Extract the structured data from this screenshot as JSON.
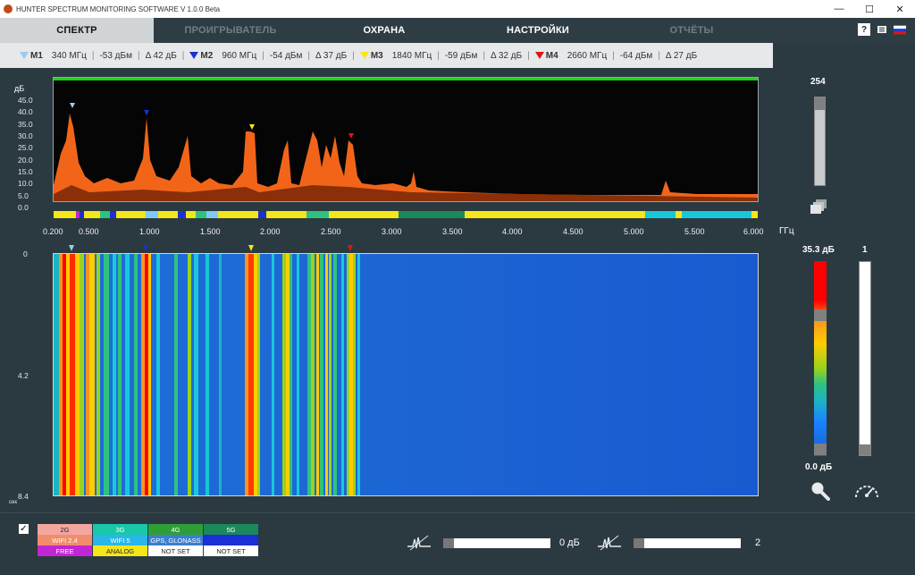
{
  "window": {
    "title": "HUNTER SPECTRUM MONITORING SOFTWARE V 1.0.0 Beta",
    "minimize": "—",
    "maximize": "☐",
    "close": "✕"
  },
  "tabs": [
    {
      "label": "СПЕКТР",
      "state": "active"
    },
    {
      "label": "ПРОИГРЫВАТЕЛЬ",
      "state": "dim"
    },
    {
      "label": "ОХРАНА",
      "state": "normal"
    },
    {
      "label": "НАСТРОЙКИ",
      "state": "normal"
    },
    {
      "label": "ОТЧЁТЫ",
      "state": "dim"
    }
  ],
  "toolbar_icons": [
    "help-icon",
    "document-icon",
    "russian-flag-icon"
  ],
  "help_label": "?",
  "markers": [
    {
      "name": "M1",
      "freq": "340 МГц",
      "level": "-53 дБм",
      "delta": "Δ 42 дБ",
      "color": "#9fc9ea"
    },
    {
      "name": "M2",
      "freq": "960 МГц",
      "level": "-54 дБм",
      "delta": "Δ 37 дБ",
      "color": "#1b2fd6"
    },
    {
      "name": "M3",
      "freq": "1840 МГц",
      "level": "-59 дБм",
      "delta": "Δ 32 дБ",
      "color": "#f5e61a"
    },
    {
      "name": "M4",
      "freq": "2660 МГц",
      "level": "-64 дБм",
      "delta": "Δ 27 дБ",
      "color": "#e01515"
    }
  ],
  "spectrum": {
    "y_unit": "дБ",
    "y_ticks": [
      "45.0",
      "40.0",
      "35.0",
      "30.0",
      "25.0",
      "20.0",
      "15.0",
      "10.0",
      "5.0",
      "0.0"
    ],
    "x_unit": "ГГц",
    "x_ticks": [
      "0.200",
      "0.500",
      "1.000",
      "1.500",
      "2.000",
      "2.500",
      "3.000",
      "3.500",
      "4.000",
      "4.500",
      "5.000",
      "5.500",
      "6.000"
    ],
    "band_colors": [
      "#f5e61a",
      "#c026d3",
      "#1b2fd6",
      "#f5e61a",
      "#2ec27e",
      "#1b2fd6",
      "#f5e61a",
      "#7fc8f8",
      "#f5e61a",
      "#1b2fd6",
      "#f5e61a",
      "#2ec27e",
      "#7fc8f8",
      "#f5e61a",
      "#1b2fd6",
      "#f5e61a",
      "#2ec27e",
      "#f5e61a",
      "#1a8a5a",
      "#f5e61a",
      "#18c8d8",
      "#f5e61a",
      "#18c8d8",
      "#f5e61a"
    ]
  },
  "waterfall": {
    "y_ticks": [
      "0",
      "4.2",
      "8.4"
    ],
    "y_unit": "сек"
  },
  "right_panel": {
    "gain_value": "254",
    "max_level": "35.3 дБ",
    "min_level": "0.0 дБ",
    "speed_value": "1",
    "icons": [
      "layers-icon",
      "zoom-icon",
      "speedometer-icon"
    ]
  },
  "legend": {
    "checked": "✓",
    "rows": [
      [
        {
          "label": "2G",
          "color": "#f3a6a0"
        },
        {
          "label": "3G",
          "color": "#18c8a8"
        },
        {
          "label": "4G",
          "color": "#2e9e38"
        },
        {
          "label": "5G",
          "color": "#1a8a5a"
        }
      ],
      [
        {
          "label": "WIFI 2.4",
          "color": "#f28d6b"
        },
        {
          "label": "WIFI 5",
          "color": "#29b6e8"
        },
        {
          "label": "GPS, GLONASS",
          "color": "#3a7fd0"
        },
        {
          "label": "",
          "color": "#1b2fd6"
        }
      ],
      [
        {
          "label": "FREE",
          "color": "#c026d3"
        },
        {
          "label": "ANALOG",
          "color": "#f5e61a"
        },
        {
          "label": "NOT SET",
          "color": "#ffffff"
        },
        {
          "label": "NOT SET",
          "color": "#ffffff"
        }
      ]
    ]
  },
  "bottom_controls": {
    "threshold_value": "0 дБ",
    "averaging_value": "2"
  }
}
